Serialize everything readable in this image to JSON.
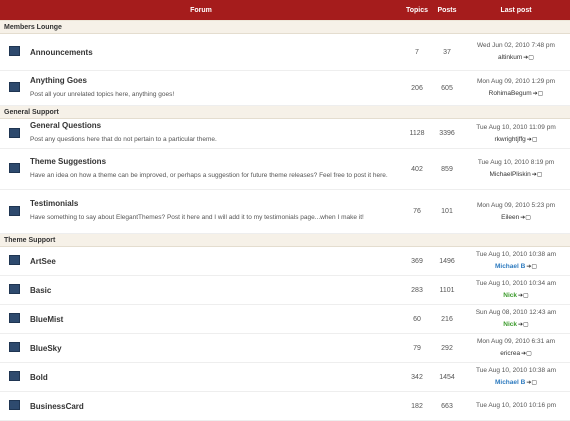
{
  "header": {
    "forum": "Forum",
    "topics": "Topics",
    "posts": "Posts",
    "last_post": "Last post"
  },
  "categories": {
    "members": "Members Lounge",
    "general": "General Support",
    "theme": "Theme Support"
  },
  "forums": [
    {
      "name": "Announcements",
      "desc": "",
      "topics": "7",
      "posts": "37",
      "date": "Wed Jun 02, 2010 7:48 pm",
      "user": "altinkum",
      "user_color": "default"
    },
    {
      "name": "Anything Goes",
      "desc": "Post all your unrelated topics here, anything goes!",
      "topics": "206",
      "posts": "605",
      "date": "Mon Aug 09, 2010 1:29 pm",
      "user": "RohimaBegum",
      "user_color": "default"
    },
    {
      "name": "General Questions",
      "desc": "Post any questions here that do not pertain to a particular theme.",
      "topics": "1128",
      "posts": "3396",
      "date": "Tue Aug 10, 2010 11:09 pm",
      "user": "rkwrightjffg",
      "user_color": "default"
    },
    {
      "name": "Theme Suggestions",
      "desc": "Have an idea on how a theme can be improved, or perhaps a suggestion for future theme releases? Feel free to post it here.",
      "topics": "402",
      "posts": "859",
      "date": "Tue Aug 10, 2010 8:19 pm",
      "user": "MichaelPliskin",
      "user_color": "default"
    },
    {
      "name": "Testimonials",
      "desc": "Have something to say about ElegantThemes? Post it here and I will add it to my testimonials page...when I make it!",
      "topics": "76",
      "posts": "101",
      "date": "Mon Aug 09, 2010 5:23 pm",
      "user": "Eileen",
      "user_color": "default"
    },
    {
      "name": "ArtSee",
      "desc": "",
      "topics": "369",
      "posts": "1496",
      "date": "Tue Aug 10, 2010 10:38 am",
      "user": "Michael B",
      "user_color": "#2e7bbf"
    },
    {
      "name": "Basic",
      "desc": "",
      "topics": "283",
      "posts": "1101",
      "date": "Tue Aug 10, 2010 10:34 am",
      "user": "Nick",
      "user_color": "#3a9a2a"
    },
    {
      "name": "BlueMist",
      "desc": "",
      "topics": "60",
      "posts": "216",
      "date": "Sun Aug 08, 2010 12:43 am",
      "user": "Nick",
      "user_color": "#3a9a2a"
    },
    {
      "name": "BlueSky",
      "desc": "",
      "topics": "79",
      "posts": "292",
      "date": "Mon Aug 09, 2010 6:31 am",
      "user": "ericrea",
      "user_color": "default"
    },
    {
      "name": "Bold",
      "desc": "",
      "topics": "342",
      "posts": "1454",
      "date": "Tue Aug 10, 2010 10:38 am",
      "user": "Michael B",
      "user_color": "#2e7bbf"
    },
    {
      "name": "BusinessCard",
      "desc": "",
      "topics": "182",
      "posts": "663",
      "date": "Tue Aug 10, 2010 10:16 pm",
      "user": "",
      "user_color": "default"
    }
  ],
  "icons": {
    "forum": "forum-unread-icon",
    "goto": "goto-last-post-icon"
  }
}
